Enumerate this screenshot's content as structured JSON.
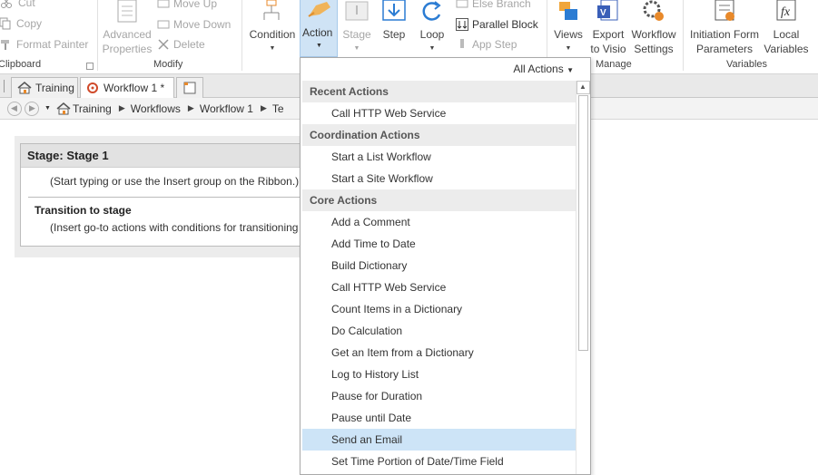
{
  "ribbon": {
    "clipboard": {
      "cut": "Cut",
      "copy": "Copy",
      "format_painter": "Format Painter",
      "group_label": "Clipboard"
    },
    "modify": {
      "advanced_properties_line1": "Advanced",
      "advanced_properties_line2": "Properties",
      "move_up": "Move Up",
      "move_down": "Move Down",
      "delete": "Delete",
      "group_label": "Modify"
    },
    "insert": {
      "condition": "Condition",
      "action": "Action",
      "stage": "Stage",
      "step": "Step",
      "loop": "Loop",
      "else_branch": "Else Branch",
      "parallel_block": "Parallel Block",
      "app_step": "App Step"
    },
    "manage": {
      "views": "Views",
      "export_line1": "Export",
      "export_line2": "to Visio",
      "settings_line1": "Workflow",
      "settings_line2": "Settings",
      "group_label": "Manage"
    },
    "variables": {
      "initiation_line1": "Initiation Form",
      "initiation_line2": "Parameters",
      "local_line1": "Local",
      "local_line2": "Variables",
      "group_label": "Variables"
    }
  },
  "tabs": [
    {
      "label": "Training"
    },
    {
      "label": "Workflow 1 *"
    }
  ],
  "breadcrumb": [
    "Training",
    "Workflows",
    "Workflow 1",
    "Te"
  ],
  "stage": {
    "title": "Stage: Stage 1",
    "hint": "(Start typing or use the Insert group on the Ribbon.)",
    "transition_title": "Transition to stage",
    "transition_hint": "(Insert go-to actions with conditions for transitioning"
  },
  "dropdown": {
    "filter": "All Actions",
    "sections": [
      {
        "header": "Recent Actions",
        "items": [
          "Call HTTP Web Service"
        ]
      },
      {
        "header": "Coordination Actions",
        "items": [
          "Start a List Workflow",
          "Start a Site Workflow"
        ]
      },
      {
        "header": "Core Actions",
        "items": [
          "Add a Comment",
          "Add Time to Date",
          "Build Dictionary",
          "Call HTTP Web Service",
          "Count Items in a Dictionary",
          "Do Calculation",
          "Get an Item from a Dictionary",
          "Log to History List",
          "Pause for Duration",
          "Pause until Date",
          "Send an Email",
          "Set Time Portion of Date/Time Field"
        ]
      }
    ],
    "selected": "Send an Email"
  },
  "colors": {
    "accent_blue": "#2b7cd3",
    "selected_bg": "#cde4f7",
    "orange": "#e8892a"
  }
}
